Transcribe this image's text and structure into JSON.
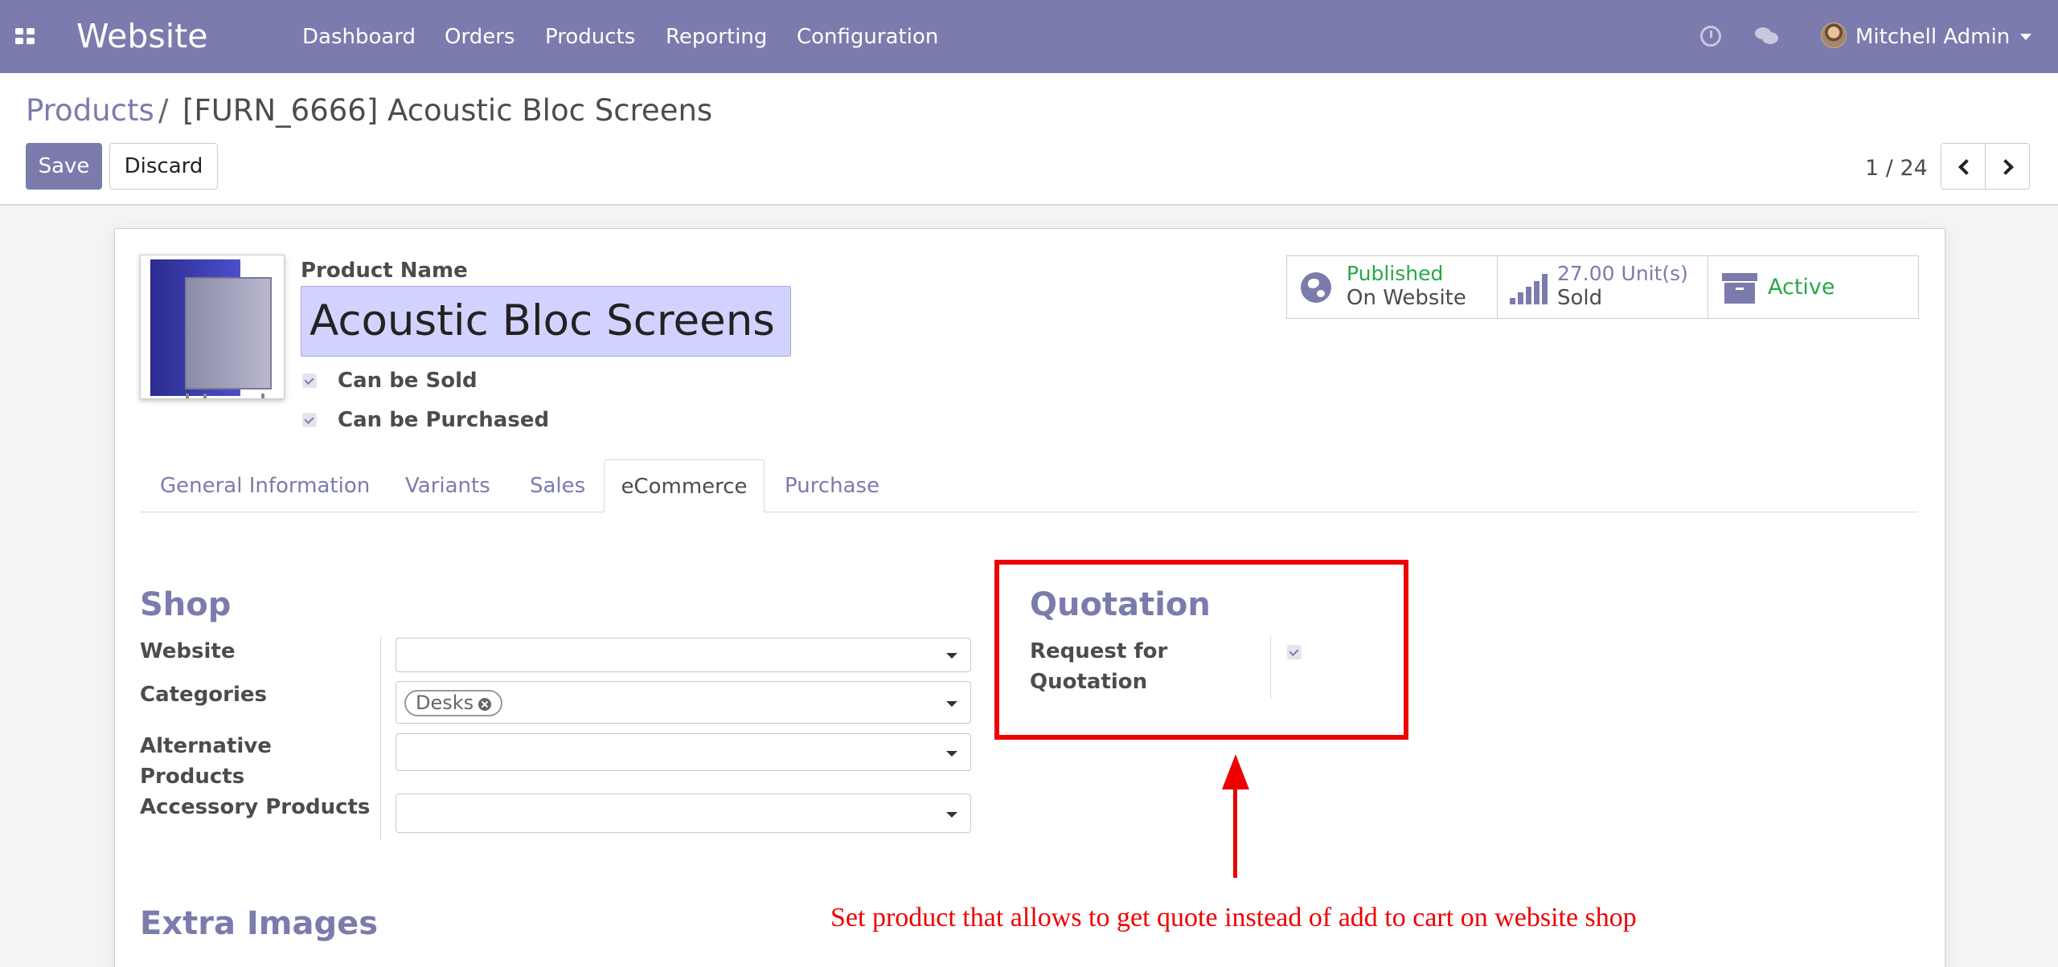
{
  "navbar": {
    "brand": "Website",
    "menu": [
      "Dashboard",
      "Orders",
      "Products",
      "Reporting",
      "Configuration"
    ],
    "user": "Mitchell Admin",
    "icons": [
      "apps-icon",
      "clock-icon",
      "chat-icon",
      "caret-down-icon"
    ]
  },
  "breadcrumb": {
    "parent": "Products",
    "separator": "/",
    "current": "[FURN_6666] Acoustic Bloc Screens"
  },
  "buttons": {
    "save": "Save",
    "discard": "Discard"
  },
  "pager": {
    "text": "1 / 24"
  },
  "product": {
    "name_label": "Product Name",
    "name": "Acoustic Bloc Screens",
    "can_be_sold": "Can be Sold",
    "can_be_purchased": "Can be Purchased",
    "can_be_sold_checked": true,
    "can_be_purchased_checked": true
  },
  "smart_buttons": {
    "website_status": "Published",
    "website_sub": "On Website",
    "sold_value": "27.00 Unit(s)",
    "sold_label": "Sold",
    "active": "Active"
  },
  "tabs": [
    "General Information",
    "Variants",
    "Sales",
    "eCommerce",
    "Purchase"
  ],
  "active_tab": "eCommerce",
  "shop": {
    "title": "Shop",
    "website_label": "Website",
    "website_value": "",
    "categories_label": "Categories",
    "category_tags": [
      "Desks"
    ],
    "alternative_label_line1": "Alternative",
    "alternative_label_line2": "Products",
    "alternative_value": "",
    "accessory_label": "Accessory Products",
    "accessory_value": ""
  },
  "quotation": {
    "title": "Quotation",
    "rfq_label_line1": "Request for",
    "rfq_label_line2": "Quotation",
    "rfq_checked": true
  },
  "extra_images": {
    "title": "Extra Images"
  },
  "annotation": {
    "text": "Set product that allows to get quote instead of add to cart on website shop",
    "color": "#ee0000"
  },
  "colors": {
    "brand": "#7c7bad",
    "published_green": "#28a745",
    "name_field_bg": "#d2d2ff"
  }
}
